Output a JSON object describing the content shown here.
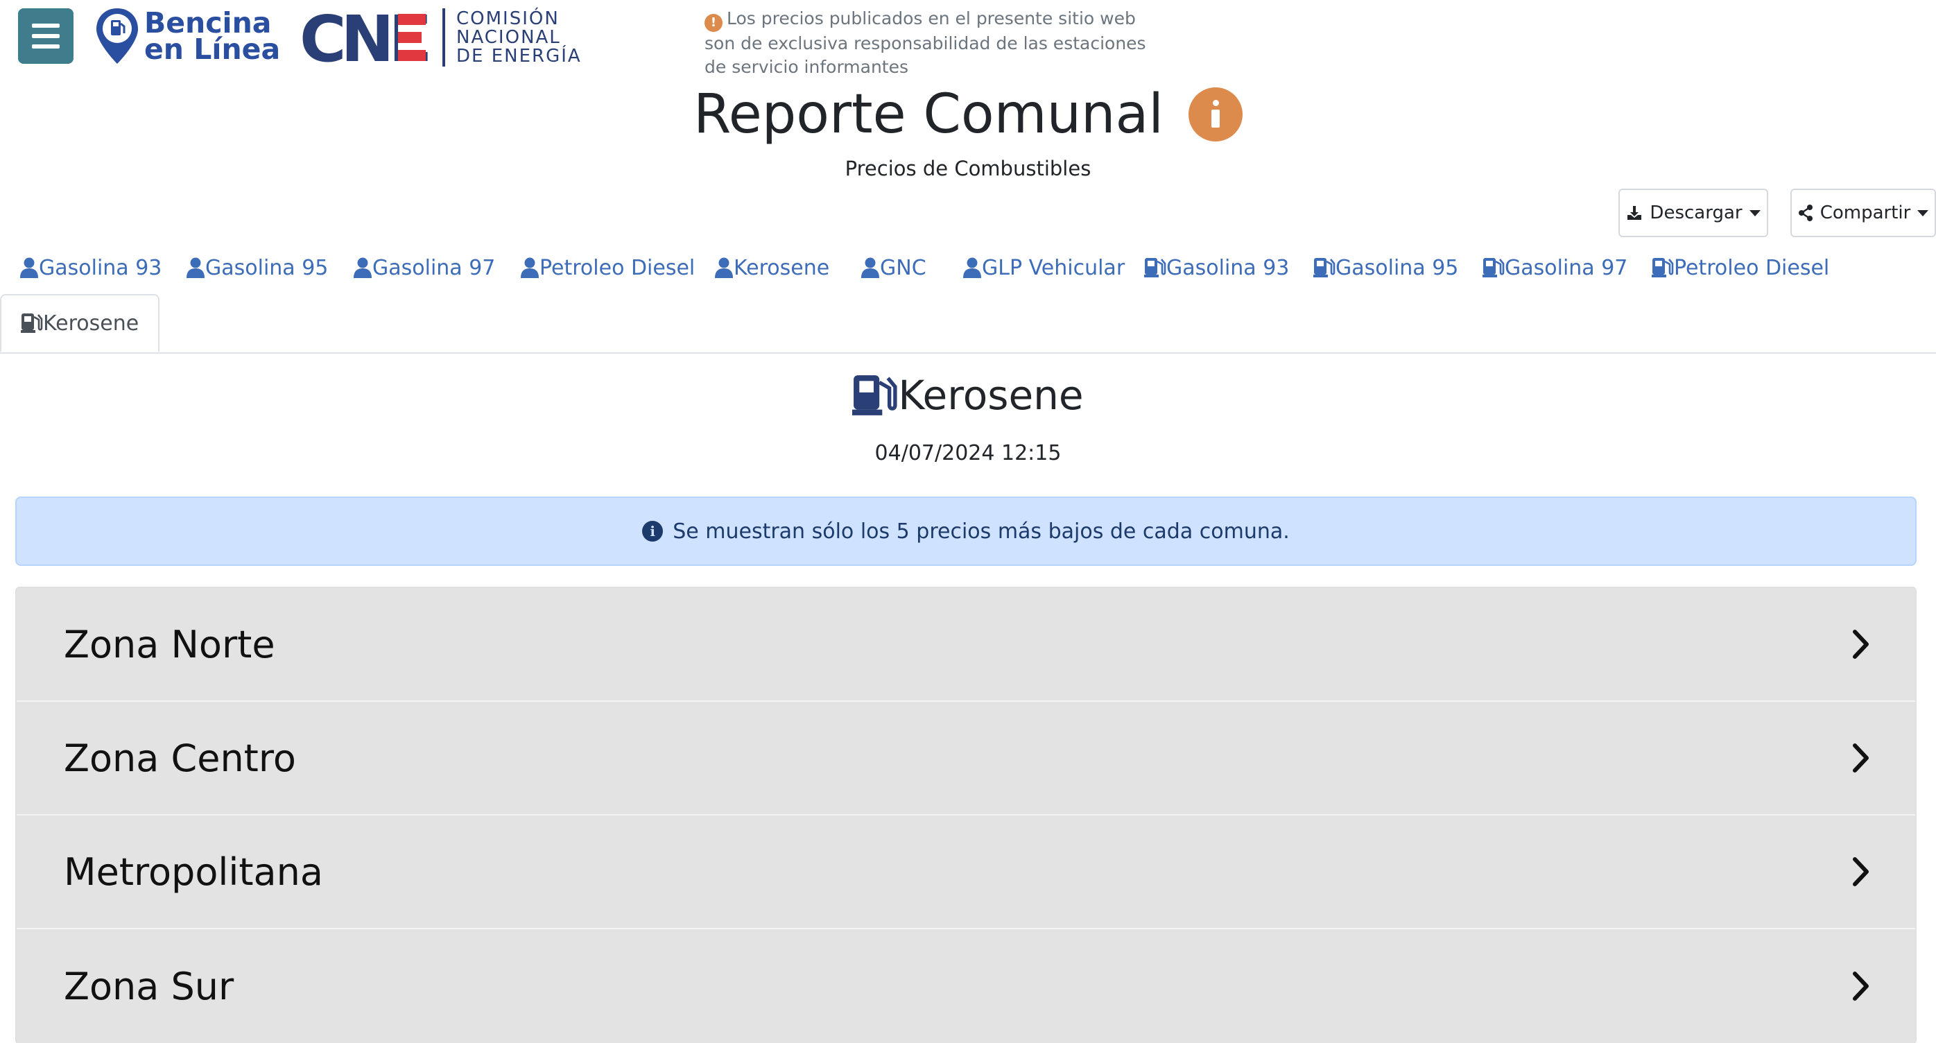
{
  "header": {
    "brand_line1": "Bencina",
    "brand_line2": "en Línea",
    "cne_letters": "CNE",
    "cne_sub1": "COMISIÓN",
    "cne_sub2": "NACIONAL",
    "cne_sub3": "DE ENERGÍA",
    "disclaimer": "Los precios publicados en el presente sitio web son de exclusiva responsabilidad de las estaciones de servicio informantes"
  },
  "page": {
    "title": "Reporte Comunal",
    "subtitle": "Precios de Combustibles"
  },
  "actions": {
    "download_label": "Descargar",
    "share_label": "Compartir"
  },
  "tabs": [
    {
      "label": "Gasolina 93",
      "icon": "user-icon"
    },
    {
      "label": "Gasolina 95",
      "icon": "user-icon"
    },
    {
      "label": "Gasolina 97",
      "icon": "user-icon"
    },
    {
      "label": "Petroleo Diesel",
      "icon": "user-icon"
    },
    {
      "label": "Kerosene",
      "icon": "user-icon"
    },
    {
      "label": "GNC",
      "icon": "user-icon"
    },
    {
      "label": "GLP Vehicular",
      "icon": "user-icon"
    },
    {
      "label": "Gasolina 93",
      "icon": "gas-pump-icon"
    },
    {
      "label": "Gasolina 95",
      "icon": "gas-pump-icon"
    },
    {
      "label": "Gasolina 97",
      "icon": "gas-pump-icon"
    },
    {
      "label": "Petroleo Diesel",
      "icon": "gas-pump-icon"
    },
    {
      "label": "Kerosene",
      "icon": "gas-pump-icon",
      "active": true
    }
  ],
  "panel": {
    "title": "Kerosene",
    "date": "04/07/2024 12:15",
    "alert": "Se muestran sólo los 5 precios más bajos de cada comuna."
  },
  "zones": [
    {
      "label": "Zona Norte"
    },
    {
      "label": "Zona Centro"
    },
    {
      "label": "Metropolitana"
    },
    {
      "label": "Zona Sur"
    }
  ],
  "colors": {
    "menu_button": "#3f7d8c",
    "accent_orange": "#dd8a4d",
    "link_blue": "#3d6cb9",
    "brand_blue": "#2b4fa0",
    "cne_red": "#e0383e",
    "alert_bg": "#cfe2ff",
    "accordion_bg": "#e3e3e3"
  }
}
